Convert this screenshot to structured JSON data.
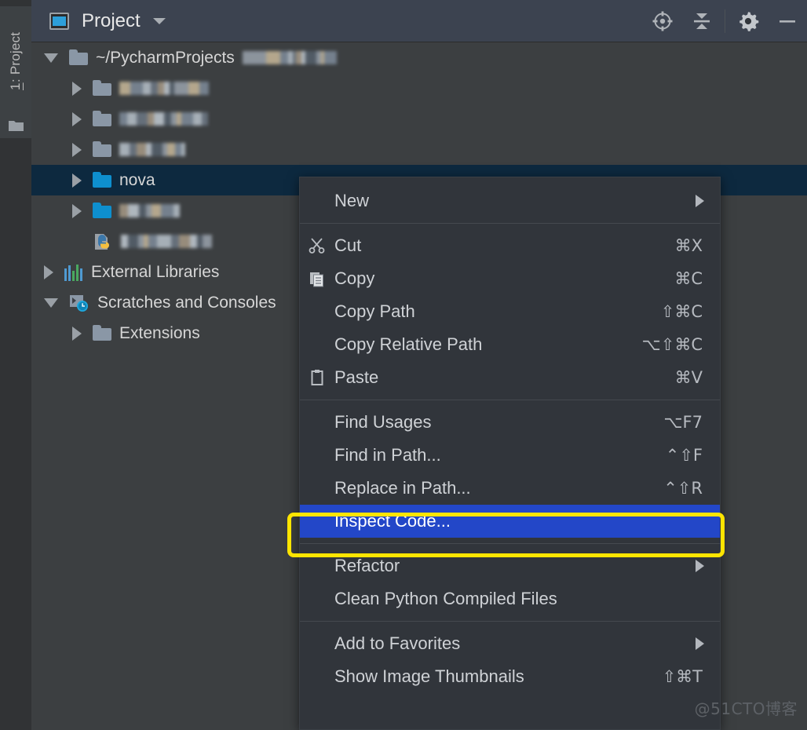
{
  "window": {
    "background": "#2b2b2b",
    "watermark": "@51CTO博客"
  },
  "tool_tab": {
    "label_prefix": "1",
    "label_suffix": ": Project",
    "icon": "folder-icon"
  },
  "panel_header": {
    "icon": "project-view-icon",
    "title": "Project",
    "dropdown_icon": "chevron-down-icon",
    "actions": [
      {
        "name": "select-opened-file-button",
        "icon": "crosshair-target-icon"
      },
      {
        "name": "collapse-all-button",
        "icon": "collapse-all-icon"
      },
      {
        "name": "settings-button",
        "icon": "gear-icon"
      },
      {
        "name": "hide-button",
        "icon": "minimize-icon"
      }
    ]
  },
  "tree": {
    "selected_row_color": "#0d293f",
    "rows": [
      {
        "indent": 16,
        "twisty": "open",
        "icon": "folder-icon",
        "icon_color": "grey",
        "label": "",
        "suffix": "~/PycharmProjects",
        "redacted": true,
        "selected": false
      },
      {
        "indent": 52,
        "twisty": "closed",
        "icon": "folder-icon",
        "icon_color": "grey",
        "label": "",
        "suffix": "",
        "redacted": true,
        "selected": false
      },
      {
        "indent": 52,
        "twisty": "closed",
        "icon": "folder-icon",
        "icon_color": "grey",
        "label": "",
        "suffix": "",
        "redacted": true,
        "selected": false
      },
      {
        "indent": 52,
        "twisty": "closed",
        "icon": "folder-icon",
        "icon_color": "grey",
        "label": "",
        "suffix": "",
        "redacted": true,
        "selected": false
      },
      {
        "indent": 52,
        "twisty": "closed",
        "icon": "folder-icon",
        "icon_color": "blue",
        "label": "nova",
        "suffix": "",
        "redacted": false,
        "selected": true
      },
      {
        "indent": 52,
        "twisty": "closed",
        "icon": "folder-icon",
        "icon_color": "blue",
        "label": "",
        "suffix": "",
        "redacted": true,
        "selected": false
      },
      {
        "indent": 52,
        "twisty": "none",
        "icon": "python-file-icon",
        "icon_color": "python",
        "label": "",
        "suffix": "",
        "redacted": true,
        "selected": false
      },
      {
        "indent": 16,
        "twisty": "closed",
        "icon": "external-libraries-icon",
        "icon_color": "libs",
        "label": "External Libraries",
        "suffix": "",
        "redacted": false,
        "selected": false
      },
      {
        "indent": 16,
        "twisty": "open",
        "icon": "scratches-icon",
        "icon_color": "scratch",
        "label": "Scratches and Consoles",
        "suffix": "",
        "redacted": false,
        "selected": false
      },
      {
        "indent": 52,
        "twisty": "closed",
        "icon": "folder-icon",
        "icon_color": "grey",
        "label": "Extensions",
        "suffix": "",
        "redacted": false,
        "selected": false
      }
    ]
  },
  "context_menu": {
    "highlight_color": "#2347c8",
    "annotation_color": "#ffe500",
    "annotated_item": "Inspect Code...",
    "groups": [
      {
        "items": [
          {
            "label": "New",
            "shortcut": "",
            "icon": "",
            "submenu": true,
            "highlighted": false
          }
        ]
      },
      {
        "items": [
          {
            "label": "Cut",
            "shortcut": "⌘X",
            "icon": "scissors-icon",
            "submenu": false,
            "highlighted": false
          },
          {
            "label": "Copy",
            "shortcut": "⌘C",
            "icon": "copy-icon",
            "submenu": false,
            "highlighted": false
          },
          {
            "label": "Copy Path",
            "shortcut": "⇧⌘C",
            "icon": "",
            "submenu": false,
            "highlighted": false
          },
          {
            "label": "Copy Relative Path",
            "shortcut": "⌥⇧⌘C",
            "icon": "",
            "submenu": false,
            "highlighted": false
          },
          {
            "label": "Paste",
            "shortcut": "⌘V",
            "icon": "clipboard-icon",
            "submenu": false,
            "highlighted": false
          }
        ]
      },
      {
        "items": [
          {
            "label": "Find Usages",
            "shortcut": "⌥F7",
            "icon": "",
            "submenu": false,
            "highlighted": false
          },
          {
            "label": "Find in Path...",
            "shortcut": "⌃⇧F",
            "icon": "",
            "submenu": false,
            "highlighted": false
          },
          {
            "label": "Replace in Path...",
            "shortcut": "⌃⇧R",
            "icon": "",
            "submenu": false,
            "highlighted": false
          },
          {
            "label": "Inspect Code...",
            "shortcut": "",
            "icon": "",
            "submenu": false,
            "highlighted": true
          }
        ]
      },
      {
        "items": [
          {
            "label": "Refactor",
            "shortcut": "",
            "icon": "",
            "submenu": true,
            "highlighted": false
          },
          {
            "label": "Clean Python Compiled Files",
            "shortcut": "",
            "icon": "",
            "submenu": false,
            "highlighted": false
          }
        ]
      },
      {
        "items": [
          {
            "label": "Add to Favorites",
            "shortcut": "",
            "icon": "",
            "submenu": true,
            "highlighted": false
          },
          {
            "label": "Show Image Thumbnails",
            "shortcut": "⇧⌘T",
            "icon": "",
            "submenu": false,
            "highlighted": false
          }
        ]
      }
    ]
  }
}
